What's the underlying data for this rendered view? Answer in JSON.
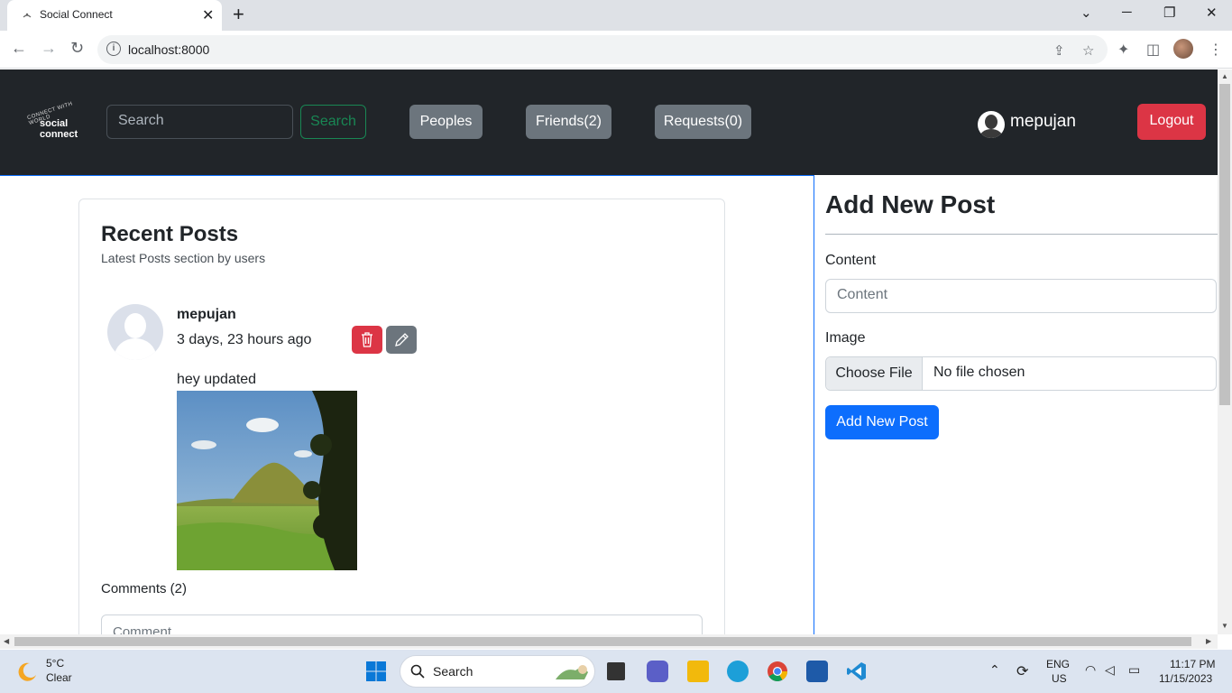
{
  "browser": {
    "tab_title": "Social Connect",
    "url": "localhost:8000"
  },
  "navbar": {
    "logo_arc": "CONNECT WITH WORLD",
    "logo_line1": "social",
    "logo_line2": "connect",
    "search_placeholder": "Search",
    "search_button": "Search",
    "peoples_button": "Peoples",
    "friends_button": "Friends(2)",
    "requests_button": "Requests(0)",
    "username": "mepujan",
    "logout_button": "Logout"
  },
  "recent_posts": {
    "title": "Recent Posts",
    "subtitle": "Latest Posts section by users",
    "post": {
      "author": "mepujan",
      "time": "3 days, 23 hours ago",
      "content": "hey updated",
      "comments_label": "Comments (2)",
      "comment_placeholder": "Comment"
    }
  },
  "add_post": {
    "title": "Add New Post",
    "content_label": "Content",
    "content_placeholder": "Content",
    "image_label": "Image",
    "choose_file": "Choose File",
    "no_file": "No file chosen",
    "submit": "Add New Post"
  },
  "taskbar": {
    "temp": "5°C",
    "weather": "Clear",
    "search": "Search",
    "lang1": "ENG",
    "lang2": "US",
    "time": "11:17 PM",
    "date": "11/15/2023"
  },
  "colors": {
    "navbar_bg": "#212529",
    "danger": "#dc3545",
    "primary": "#0d6efd",
    "secondary": "#6c757d",
    "success": "#198754"
  }
}
